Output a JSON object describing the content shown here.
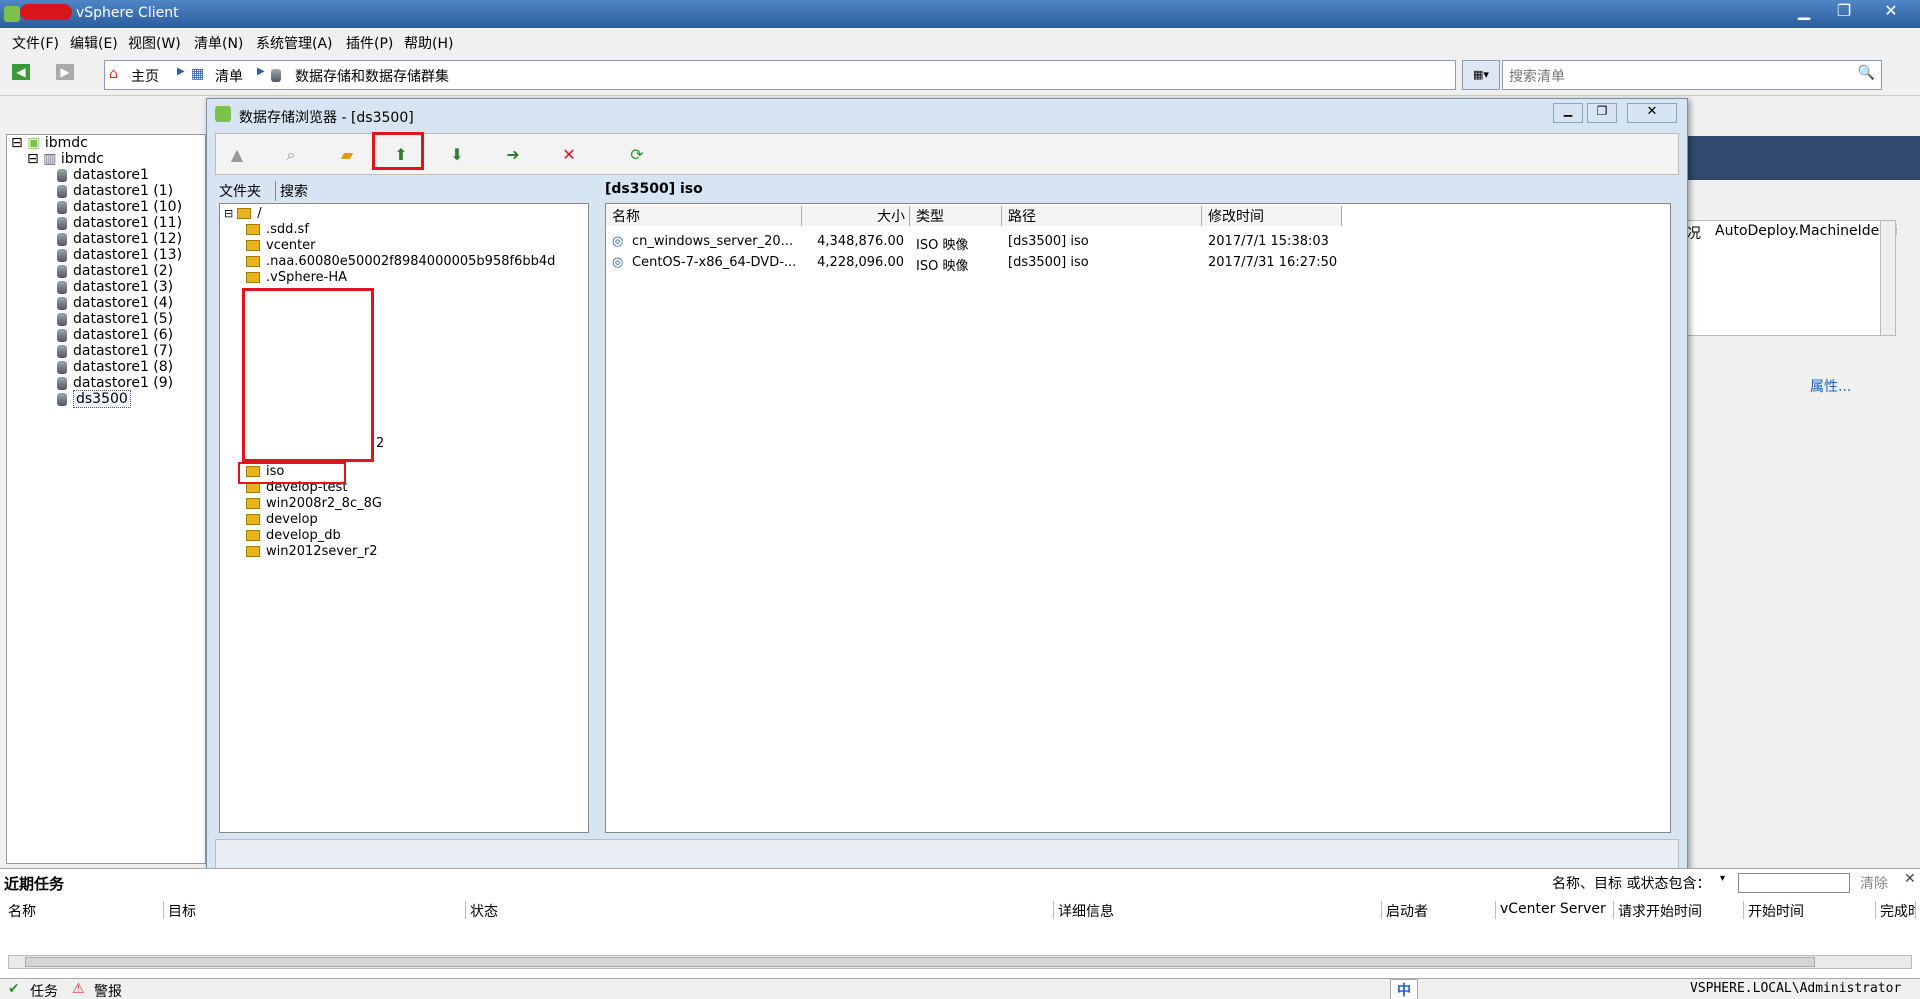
{
  "window": {
    "title": "vSphere Client"
  },
  "menu": [
    "文件(F)",
    "编辑(E)",
    "视图(W)",
    "清单(N)",
    "系统管理(A)",
    "插件(P)",
    "帮助(H)"
  ],
  "nav": {
    "home": "主页",
    "inventory": "清单",
    "datastores": "数据存储和数据存储群集",
    "search_placeholder": "搜索清单"
  },
  "tree": {
    "root": "ibmdc",
    "datacenter": "ibmdc",
    "datastores": [
      "datastore1",
      "datastore1 (1)",
      "datastore1 (10)",
      "datastore1 (11)",
      "datastore1 (12)",
      "datastore1 (13)",
      "datastore1 (2)",
      "datastore1 (3)",
      "datastore1 (4)",
      "datastore1 (5)",
      "datastore1 (6)",
      "datastore1 (7)",
      "datastore1 (8)",
      "datastore1 (9)",
      "ds3500"
    ]
  },
  "background_panel": {
    "col1": "况",
    "col2": "AutoDeploy.MachineIdenti",
    "properties_link": "属性..."
  },
  "browser": {
    "title": "数据存储浏览器 - [ds3500]",
    "tabs": [
      "文件夹",
      "搜索"
    ],
    "current_path": "[ds3500] iso",
    "folders_top": [
      "/",
      ".sdd.sf",
      "vcenter",
      ".naa.60080e50002f8984000005b958f6bb4d",
      ".vSphere-HA"
    ],
    "hidden_fragment": "2",
    "folders_bottom": [
      "iso",
      "develop-test",
      "win2008r2_8c_8G",
      "develop",
      "develop_db",
      "win2012sever_r2"
    ],
    "columns": [
      "名称",
      "大小",
      "类型",
      "路径",
      "修改时间"
    ],
    "files": [
      {
        "name": "cn_windows_server_20...",
        "size": "4,348,876.00",
        "type": "ISO 映像",
        "path": "[ds3500] iso",
        "modified": "2017/7/1 15:38:03"
      },
      {
        "name": "CentOS-7-x86_64-DVD-...",
        "size": "4,228,096.00",
        "type": "ISO 映像",
        "path": "[ds3500] iso",
        "modified": "2017/7/31 16:27:50"
      }
    ]
  },
  "tasks": {
    "title": "近期任务",
    "filter_label": "名称、目标 或状态包含：",
    "clear": "清除",
    "columns": [
      "名称",
      "目标",
      "状态",
      "详细信息",
      "启动者",
      "vCenter Server",
      "请求开始时间",
      "开始时间",
      "完成时"
    ]
  },
  "status": {
    "tasks": "任务",
    "alarms": "警报",
    "ime": "中",
    "user": "VSPHERE.LOCAL\\Administrator"
  },
  "colors": {
    "highlight": "#e0141e",
    "titlebar": "#2b5c9e"
  }
}
